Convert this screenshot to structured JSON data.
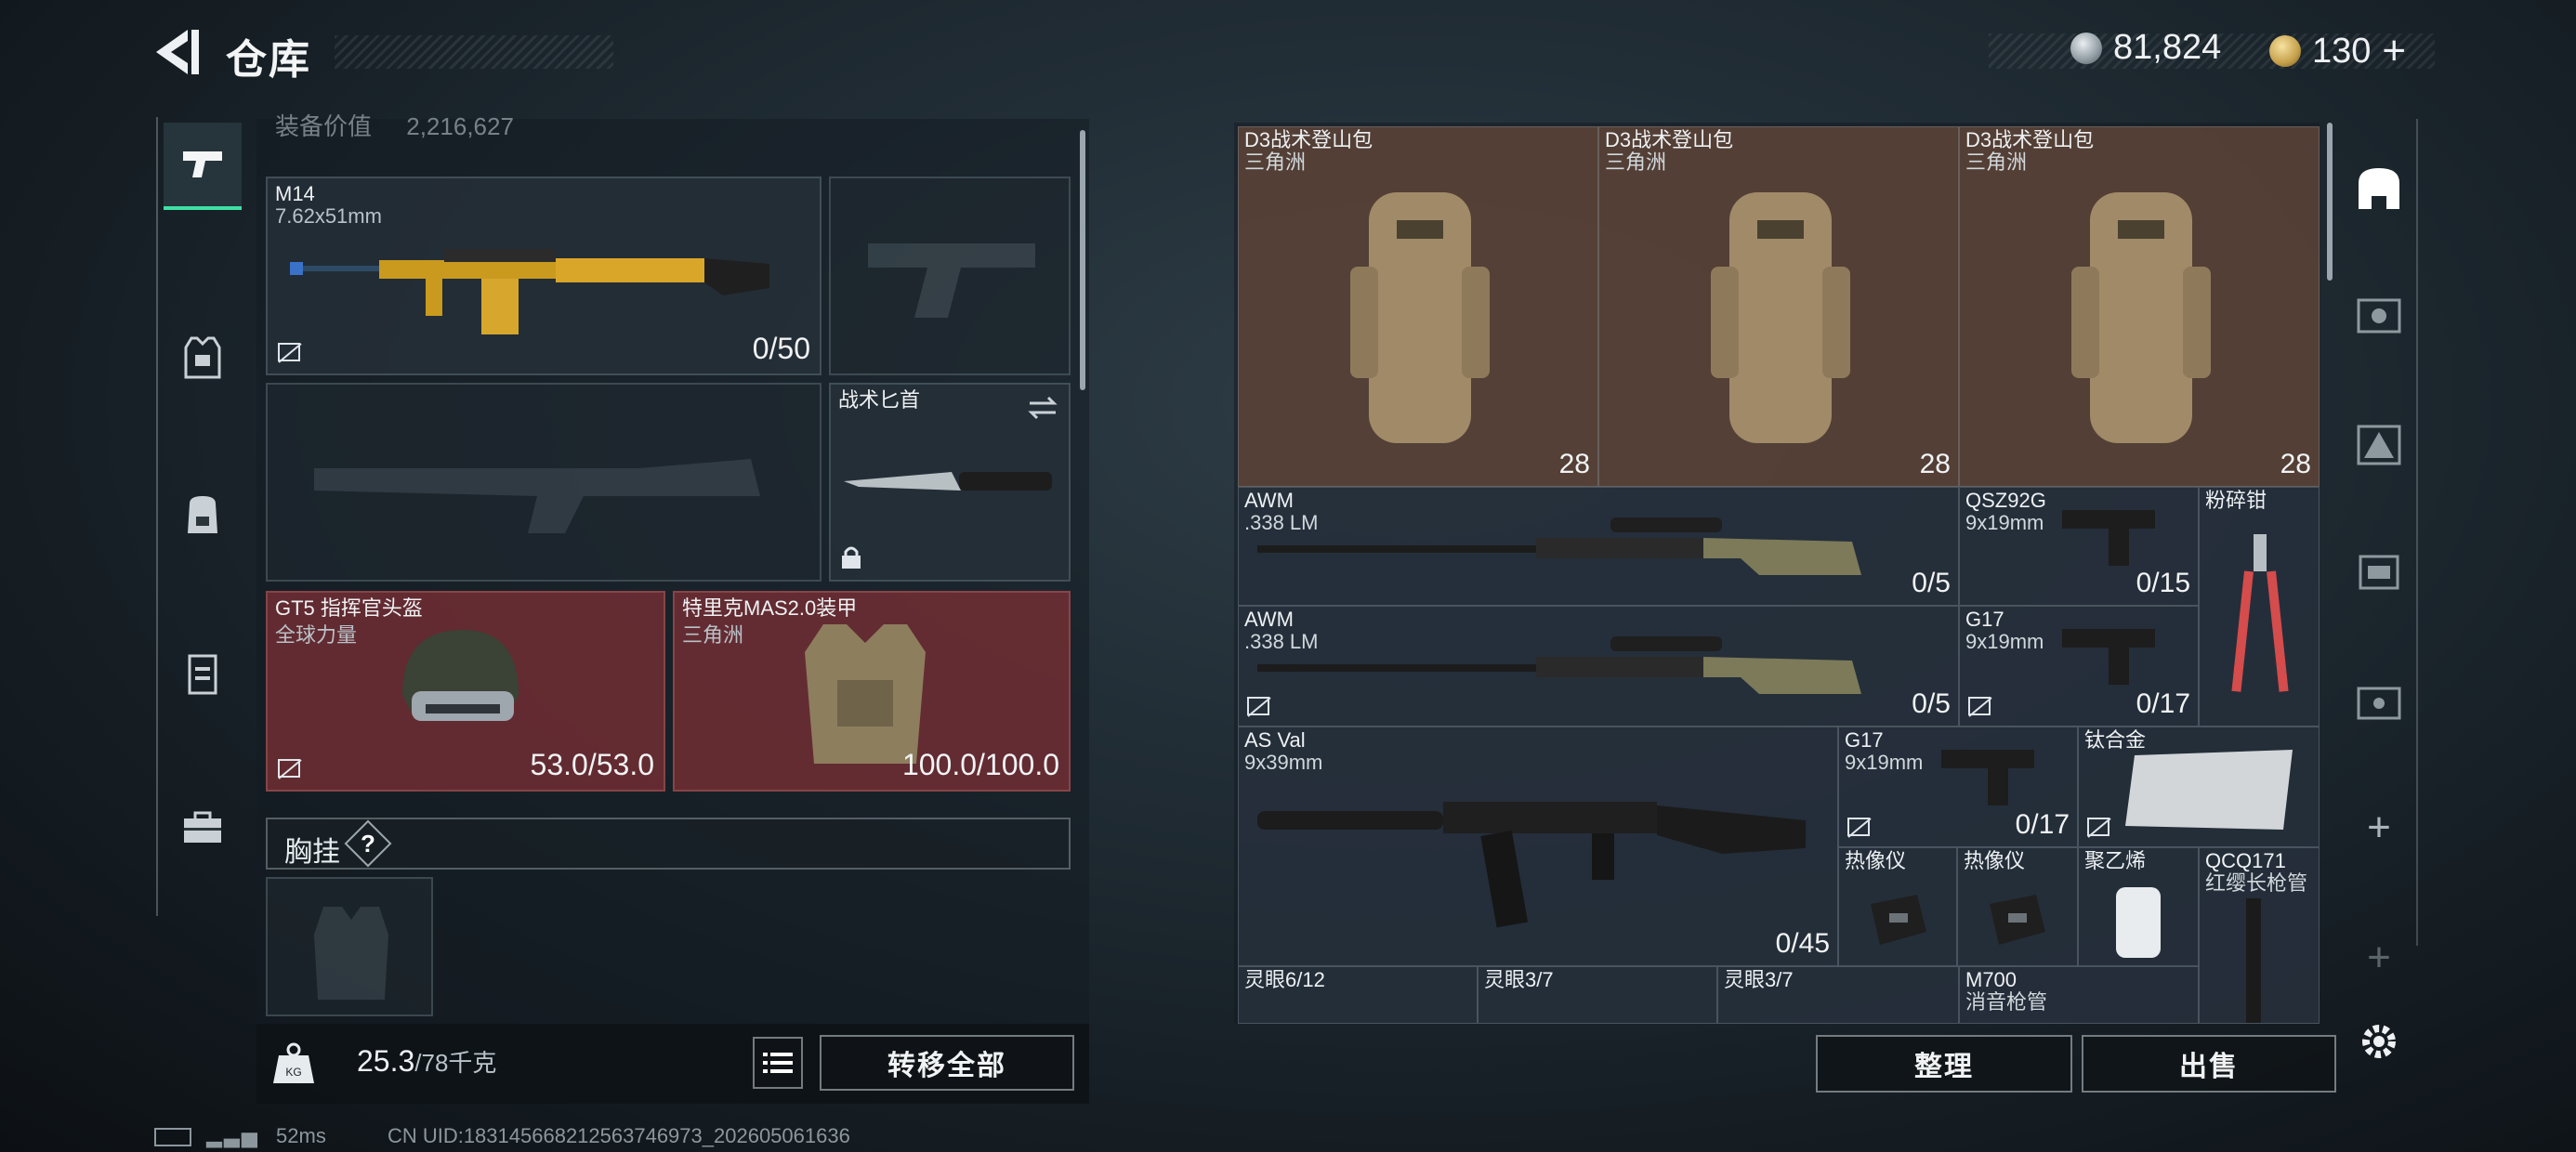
{
  "header": {
    "title": "仓库",
    "currency_silver": "81,824",
    "currency_gold": "130",
    "plus": "+"
  },
  "left_panel": {
    "value_label": "装备价值",
    "value_amount": "2,216,627",
    "primary_weapon": {
      "name": "M14",
      "caliber": "7.62x51mm",
      "ammo": "0/50"
    },
    "melee": {
      "name": "战术匕首"
    },
    "helmet": {
      "name": "GT5 指挥官头盔",
      "sub": "全球力量",
      "durability": "53.0/53.0"
    },
    "armor": {
      "name": "特里克MAS2.0装甲",
      "sub": "三角洲",
      "durability": "100.0/100.0"
    },
    "chest_rig": {
      "label": "胸挂",
      "help": "?"
    },
    "weight": {
      "current": "25.3",
      "max": "/78千克"
    },
    "transfer_all": "转移全部"
  },
  "stash": {
    "items": [
      {
        "name": "D3战术登山包",
        "sub": "三角洲",
        "count": "28"
      },
      {
        "name": "D3战术登山包",
        "sub": "三角洲",
        "count": "28"
      },
      {
        "name": "D3战术登山包",
        "sub": "三角洲",
        "count": "28"
      },
      {
        "name": "AWM",
        "sub": ".338 LM",
        "count": "0/5"
      },
      {
        "name": "QSZ92G",
        "sub": "9x19mm",
        "count": "0/15"
      },
      {
        "name": "粉碎钳",
        "sub": "",
        "count": ""
      },
      {
        "name": "AWM",
        "sub": ".338 LM",
        "count": "0/5"
      },
      {
        "name": "G17",
        "sub": "9x19mm",
        "count": "0/17"
      },
      {
        "name": "AS Val",
        "sub": "9x39mm",
        "count": "0/45"
      },
      {
        "name": "G17",
        "sub": "9x19mm",
        "count": "0/17"
      },
      {
        "name": "钛合金",
        "sub": "",
        "count": ""
      },
      {
        "name": "热像仪",
        "sub": "",
        "count": ""
      },
      {
        "name": "热像仪",
        "sub": "",
        "count": ""
      },
      {
        "name": "聚乙烯",
        "sub": "",
        "count": ""
      },
      {
        "name": "QCQ171",
        "sub": "红缨长枪管",
        "count": ""
      },
      {
        "name": "灵眼6/12",
        "sub": "",
        "count": ""
      },
      {
        "name": "灵眼3/7",
        "sub": "",
        "count": ""
      },
      {
        "name": "灵眼3/7",
        "sub": "",
        "count": ""
      },
      {
        "name": "M700",
        "sub": "消音枪管",
        "count": ""
      }
    ],
    "sort_button": "整理",
    "sell_button": "出售"
  },
  "status_bar": {
    "ping": "52ms",
    "uid": "CN UID:183145668212563746973_202605061636"
  },
  "colors": {
    "accent": "#3fe0a6",
    "red_slot": "#7a3034",
    "brown_slot": "#604638"
  }
}
